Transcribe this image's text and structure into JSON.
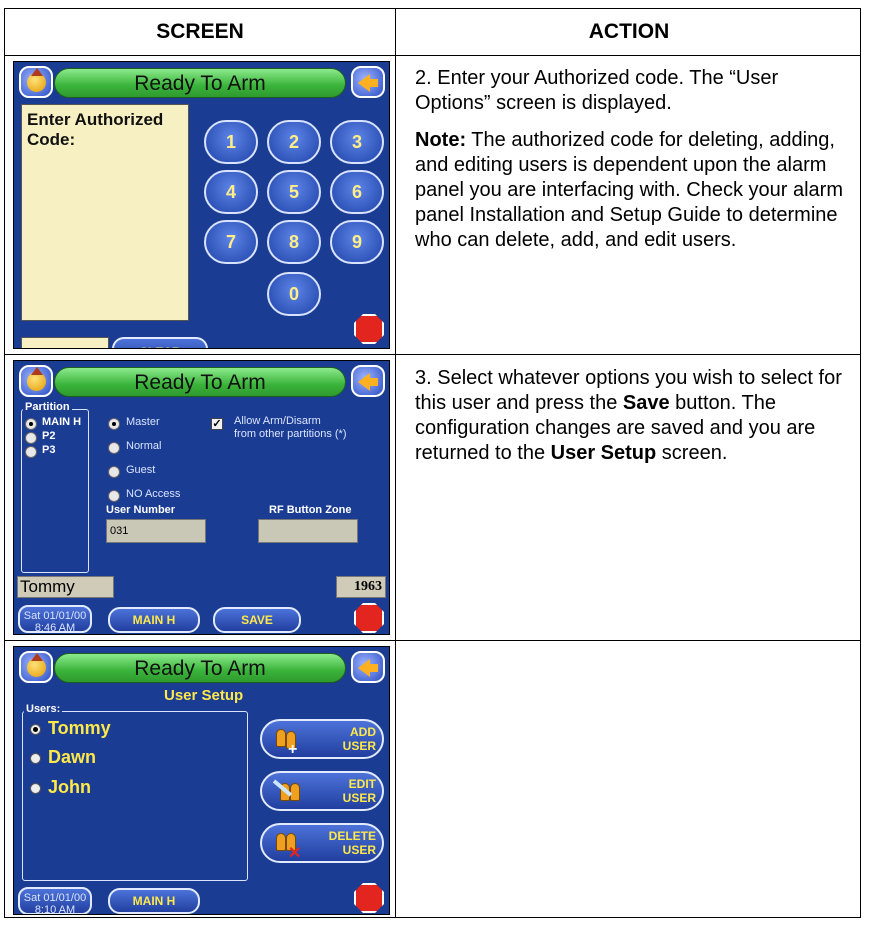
{
  "table": {
    "headers": [
      "SCREEN",
      "ACTION"
    ]
  },
  "rows": [
    {
      "action": {
        "p1": "2.  Enter your Authorized code.  The “User Options” screen is displayed.",
        "note_label": "Note:",
        "note_text": " The authorized code for deleting, adding, and editing users is dependent upon the alarm panel you are interfacing with. Check your alarm panel Installation and Setup Guide to determine who can delete, add, and edit users."
      },
      "screen": {
        "title": "Ready To Arm",
        "prompt_line1": "Enter Authorized",
        "prompt_line2": "Code:",
        "keys": [
          "1",
          "2",
          "3",
          "4",
          "5",
          "6",
          "7",
          "8",
          "9",
          "0"
        ],
        "clear_label": "CLEAR"
      }
    },
    {
      "action": {
        "p1_a": "3.  Select whatever options you wish to select for this user and press the ",
        "save_word": "Save",
        "p1_b": " button.  The configuration changes are saved and you are returned to the ",
        "user_setup_word": "User Setup",
        "p1_c": " screen."
      },
      "screen": {
        "title": "Ready To Arm",
        "partition_label": "Partition",
        "partitions": [
          "MAIN H",
          "P2",
          "P3"
        ],
        "options": [
          "Master",
          "Normal",
          "Guest",
          "NO Access"
        ],
        "allow_label_line1": "Allow Arm/Disarm",
        "allow_label_line2": "from other partitions (*)",
        "user_number_label": "User Number",
        "user_number_value": "031",
        "rf_zone_label": "RF Button Zone",
        "user_name": "Tommy",
        "user_code": "1963",
        "date_line1": "Sat 01/01/00",
        "date_line2": "8:46 AM",
        "main_label": "MAIN H",
        "save_label": "SAVE"
      }
    },
    {
      "screen": {
        "title": "Ready To Arm",
        "heading": "User Setup",
        "users_label": "Users:",
        "users": [
          "Tommy",
          "Dawn",
          "John"
        ],
        "add_line1": "ADD",
        "add_line2": "USER",
        "edit_line1": "EDIT",
        "edit_line2": "USER",
        "delete_line1": "DELETE",
        "delete_line2": "USER",
        "date_line1": "Sat 01/01/00",
        "date_line2": "8:10 AM",
        "main_label": "MAIN H"
      }
    }
  ]
}
